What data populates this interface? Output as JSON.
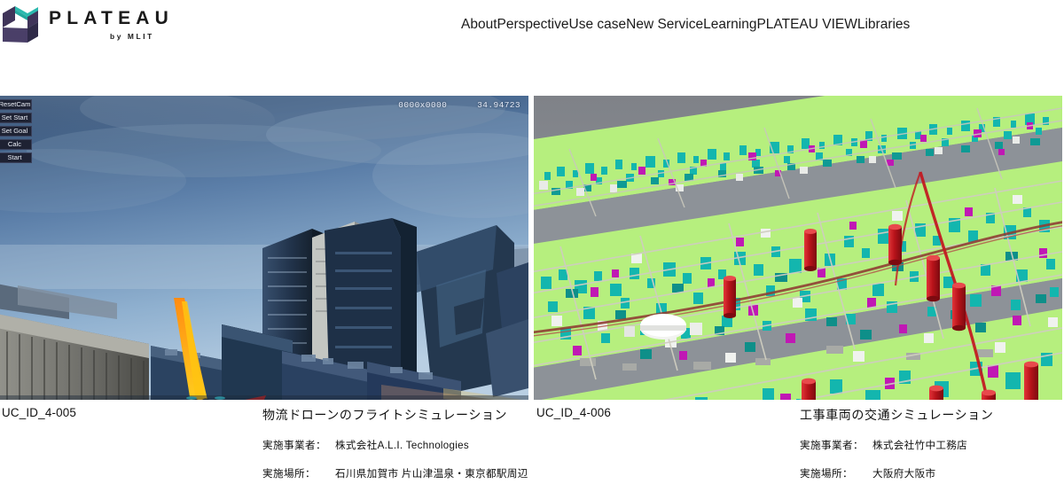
{
  "header": {
    "logo": {
      "name": "PLATEAU",
      "sub": "by MLIT",
      "mark_colors": {
        "top": "#2bb9ae",
        "left": "#3f3459",
        "right": "#2f2a48",
        "front": "#4a3f68"
      }
    },
    "nav": [
      {
        "label": "About"
      },
      {
        "label": "Perspective"
      },
      {
        "label": "Use case"
      },
      {
        "label": "New Service"
      },
      {
        "label": "Learning"
      },
      {
        "label": "PLATEAU VIEW"
      },
      {
        "label": "Libraries"
      }
    ]
  },
  "cards": [
    {
      "id": "UC_ID_4-005",
      "title": "物流ドローンのフライトシミュレーション",
      "meta": [
        {
          "label": "実施事業者：",
          "value": "株式会社A.L.I. Technologies"
        },
        {
          "label": "実施場所：",
          "value": "石川県加賀市 片山津温泉・東京都駅周辺"
        }
      ],
      "overlay": {
        "buttons": [
          "ResetCam",
          "Set Start",
          "Set Goal",
          "Calc",
          "Start"
        ],
        "resolution": "0000x0000",
        "value": "34.94723"
      }
    },
    {
      "id": "UC_ID_4-006",
      "title": "工事車両の交通シミュレーション",
      "meta": [
        {
          "label": "実施事業者：",
          "value": "株式会社竹中工務店"
        },
        {
          "label": "実施場所：",
          "value": "大阪府大阪市"
        }
      ]
    }
  ],
  "colors": {
    "teal_building": "#18b3ac",
    "green_ground": "#a8f06a",
    "magenta_building": "#c018b4",
    "red_marker": "#c0181c",
    "water_gray": "#8d9298",
    "sky_blue": "#4b6c94"
  }
}
